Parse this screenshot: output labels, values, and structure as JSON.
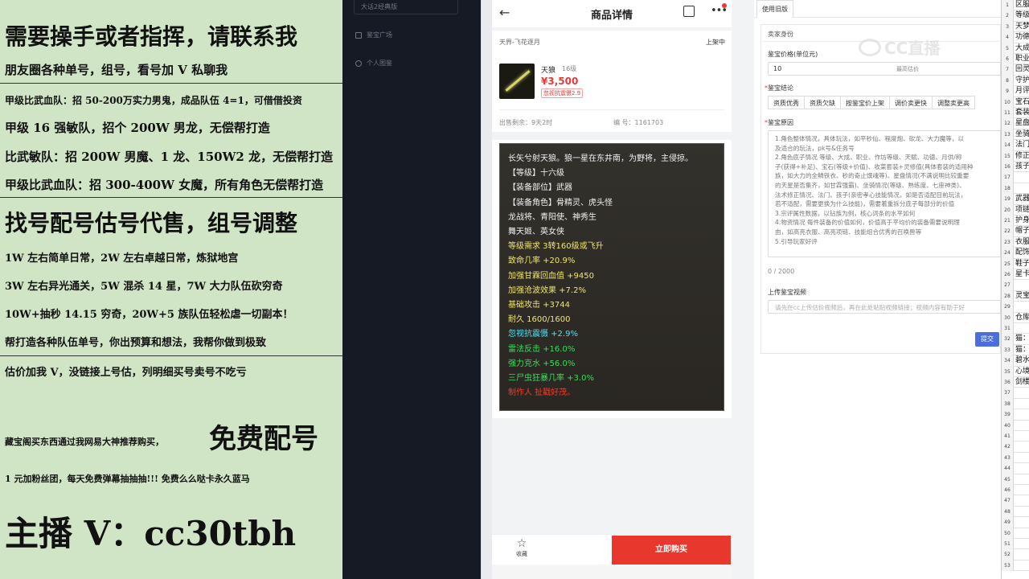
{
  "promo": {
    "l1": "需要操手或者指挥，请联系我",
    "l2": "朋友圈各种单号，组号，看号加 V 私聊我",
    "l3": "甲级比武血队：招 50-200万实力男鬼，成品队伍 4=1，可借借投资",
    "l4": "甲级 16 强敏队，招个 200W 男龙，无偿帮打造",
    "l5": "比武敏队：招 200W 男魔、1 龙、150W2 龙，无偿帮打造",
    "l6": "甲级比武血队：招 300-400W 女魔，所有角色无偿帮打造",
    "l7": "找号配号估号代售，组号调整",
    "l8": "1W 左右简单日常，2W 左右卓越日常，炼狱地宫",
    "l9": "3W 左右异光通关，5W 混杀 14 星，7W 大力队伍砍穷奇",
    "l10": "10W+抽秒 14.15 穷奇，20W+5 族队伍轻松虐一切副本！",
    "l11": "帮打造各种队伍单号，你出预算和想法，我帮你做到极致",
    "l12": "估价加我 V，没链接上号估，列明细买号卖号不吃亏",
    "l13a": "藏宝阁买东西通过我网易大神推荐购买，",
    "l13b": "免费配号",
    "l14": "1 元加粉丝团，每天免费弹幕抽抽抽!!! 免费么么哒卡永久蓝马",
    "l15": "主播 V：cc30tbh"
  },
  "sidebar": {
    "dropdown": "大话2经典版",
    "nav1": "鉴宝广场",
    "nav2": "个人图鉴"
  },
  "product": {
    "header_title": "商品详情",
    "back": "←",
    "more": "•••",
    "server": "天界-飞花逐月",
    "status": "上架中",
    "name": "天狼",
    "level": "16级",
    "price": "¥3,500",
    "tag": "忽视抗震慑2.9",
    "remain": "出售剩余：9天2时",
    "number": "编 号：1161703",
    "tooltip": [
      {
        "text": "长矢兮射天狼。狼一星在东井南，为野将，主侵掠。",
        "color": "white"
      },
      {
        "text": "【等级】十六级",
        "color": "white"
      },
      {
        "text": "【装备部位】武器",
        "color": "white"
      },
      {
        "text": "【装备角色】骨精灵、虎头怪",
        "color": "white"
      },
      {
        "text": "龙战将、青阳使、神秀生",
        "color": "white"
      },
      {
        "text": "舞天姬、英女侠",
        "color": "white"
      },
      {
        "text": "等级需求 3转160级或飞升",
        "color": "yellow"
      },
      {
        "text": "致命几率 +20.9%",
        "color": "yellow"
      },
      {
        "text": "加强甘霖回血值 +9450",
        "color": "yellow"
      },
      {
        "text": "加强沧波效果 +7.2%",
        "color": "yellow"
      },
      {
        "text": "基础攻击 +3744",
        "color": "yellow"
      },
      {
        "text": "耐久 1600/1600",
        "color": "yellow"
      },
      {
        "text": "忽视抗震慑 +2.9%",
        "color": "cyan"
      },
      {
        "text": "雷法反击 +16.0%",
        "color": "green"
      },
      {
        "text": "强力克水 +56.0%",
        "color": "green"
      },
      {
        "text": "三尸虫狂暴几率 +3.0%",
        "color": "green"
      },
      {
        "text": "制作人 扯戳好茂。",
        "color": "red"
      }
    ],
    "fav_label": "收藏",
    "fav_icon": "☆",
    "buy_label": "立即购买"
  },
  "form": {
    "tab": "使用旧版",
    "section": "卖家身份",
    "price_label": "鉴宝价格(单位元)",
    "price_value": "10",
    "price_hint": "最高估价",
    "conclusion_label": "鉴宝结论",
    "conclusion_options": [
      "资质优秀",
      "资质欠缺",
      "按鉴宝价上架",
      "调价卖更快",
      "调整卖更高"
    ],
    "reason_label": "鉴宝原因",
    "reason_lines": [
      "1.角色整体情况，具体玩法，如平秒仙、程度炮、砍龙、大力魔等，以",
      "及适合的玩法，pk号&任务号",
      "2.角色底子情况 等级、大成、职业、作坊等级、天赋、功德、月供/称",
      "子(获得+补足)、宝石(等级+价值)、收菜套装+灵修值(具体套装的适用种",
      "族，如大力的全鳞铁衣、秒的奇止馔魂等)、星盘情况(不满说明比较重要",
      "的天星是否集齐，如甘霖强霸)、坐骑情况(等级、熟练度、七座神类)、",
      "法术修正情况、法门、孩子(亲密孝心技能情况，如是否适配目前玩法，",
      "若不适配，需要更换为什么技能)，需要着重拆分底子每部分的价值",
      "3.宗评属性数据，以钻族为例，核心词条的水平如何",
      "4.物资情况 每件装备的价值如何，价值高于平均价的装备需要说明理",
      "由，如高亮衣服、高亮项链、技能组合优秀的召唤兽等",
      "5.引导玩家好评"
    ],
    "counter": "0 / 2000",
    "video_label": "上传鉴宝视频",
    "video_placeholder": "请先在cc上传估价视频后，再在此处粘贴视频链接；视频内容有助于好",
    "submit": "提交",
    "watermark": "CC直播"
  },
  "sheet": {
    "rows": [
      {
        "n": "1",
        "t": "区服"
      },
      {
        "n": "2",
        "t": "等级"
      },
      {
        "n": "3",
        "t": "天梦"
      },
      {
        "n": "4",
        "t": "功德"
      },
      {
        "n": "5",
        "t": "大成"
      },
      {
        "n": "6",
        "t": "职业"
      },
      {
        "n": "7",
        "t": "回灵"
      },
      {
        "n": "8",
        "t": "守护"
      },
      {
        "n": "9",
        "t": "月评"
      },
      {
        "n": "10",
        "t": "宝石"
      },
      {
        "n": "11",
        "t": "套装"
      },
      {
        "n": "12",
        "t": "星盘"
      },
      {
        "n": "13",
        "t": "坐骑"
      },
      {
        "n": "14",
        "t": "法门"
      },
      {
        "n": "15",
        "t": "修正"
      },
      {
        "n": "16",
        "t": "孩子"
      },
      {
        "n": "17",
        "t": ""
      },
      {
        "n": "18",
        "t": ""
      },
      {
        "n": "19",
        "t": "武器"
      },
      {
        "n": "20",
        "t": "项链"
      },
      {
        "n": "21",
        "t": "护身"
      },
      {
        "n": "22",
        "t": "帽子"
      },
      {
        "n": "23",
        "t": "衣服"
      },
      {
        "n": "24",
        "t": "配饰"
      },
      {
        "n": "25",
        "t": "鞋子"
      },
      {
        "n": "26",
        "t": "星卡"
      },
      {
        "n": "27",
        "t": ""
      },
      {
        "n": "28",
        "t": "灵宝"
      },
      {
        "n": "29",
        "t": ""
      },
      {
        "n": "30",
        "t": "仓库"
      },
      {
        "n": "31",
        "t": ""
      },
      {
        "n": "32",
        "t": "猫："
      },
      {
        "n": "33",
        "t": "猫："
      },
      {
        "n": "34",
        "t": "碧水"
      },
      {
        "n": "35",
        "t": "心境"
      },
      {
        "n": "36",
        "t": "剑楼"
      },
      {
        "n": "37",
        "t": ""
      },
      {
        "n": "38",
        "t": ""
      },
      {
        "n": "39",
        "t": ""
      },
      {
        "n": "40",
        "t": ""
      },
      {
        "n": "41",
        "t": ""
      },
      {
        "n": "42",
        "t": ""
      },
      {
        "n": "43",
        "t": ""
      },
      {
        "n": "44",
        "t": ""
      },
      {
        "n": "45",
        "t": ""
      },
      {
        "n": "46",
        "t": ""
      },
      {
        "n": "47",
        "t": ""
      },
      {
        "n": "48",
        "t": ""
      },
      {
        "n": "49",
        "t": ""
      },
      {
        "n": "50",
        "t": ""
      },
      {
        "n": "51",
        "t": ""
      },
      {
        "n": "52",
        "t": ""
      },
      {
        "n": "53",
        "t": ""
      }
    ]
  },
  "colors": {
    "accent_red": "#e8372c",
    "submit_blue": "#4a6ee0",
    "promo_bg": "#cfe5c6"
  }
}
